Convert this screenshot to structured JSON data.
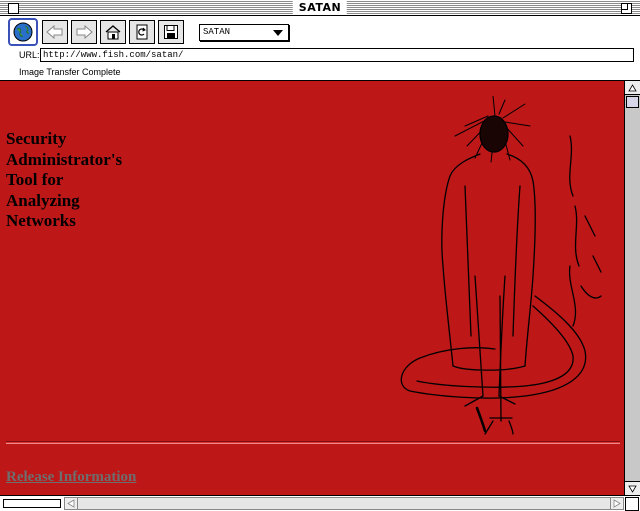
{
  "window": {
    "title": "SATAN"
  },
  "toolbar": {
    "buttons": [
      {
        "name": "globe",
        "icon": "globe-icon"
      },
      {
        "name": "back",
        "icon": "back-arrow-icon"
      },
      {
        "name": "forward",
        "icon": "forward-arrow-icon"
      },
      {
        "name": "home",
        "icon": "home-icon"
      },
      {
        "name": "reload",
        "icon": "reload-icon"
      },
      {
        "name": "save",
        "icon": "floppy-disk-icon"
      }
    ],
    "site_select": "SATAN"
  },
  "url": {
    "label": "URL:",
    "value": "http://www.fish.com/satan/"
  },
  "status": {
    "text": "Image Transfer Complete"
  },
  "content": {
    "background_color": "#bd1718",
    "headline": [
      "Security",
      "Administrator's",
      "Tool for",
      "Analyzing",
      "Networks"
    ],
    "release_link": "Release Information",
    "link_color": "#6e6e6e"
  }
}
